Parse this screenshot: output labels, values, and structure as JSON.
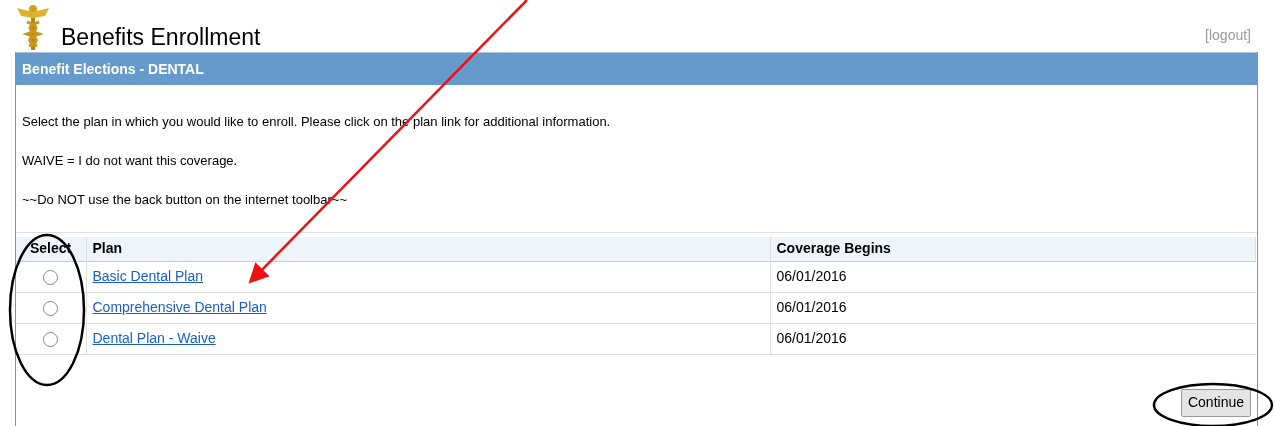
{
  "header": {
    "title": "Benefits Enrollment",
    "logout": "[logout]"
  },
  "panel": {
    "title": "Benefit Elections - DENTAL",
    "instructions": [
      "Select the plan in which you would like to enroll. Please click on the plan link for additional information.",
      "WAIVE = I do not want this coverage.",
      "~~Do NOT use the back button on the internet toolbar~~"
    ],
    "table": {
      "columns": [
        "Select",
        "Plan",
        "Coverage Begins"
      ],
      "rows": [
        {
          "selected": false,
          "plan": "Basic Dental Plan",
          "coverage_begins": "06/01/2016"
        },
        {
          "selected": false,
          "plan": "Comprehensive Dental Plan",
          "coverage_begins": "06/01/2016"
        },
        {
          "selected": false,
          "plan": "Dental Plan - Waive",
          "coverage_begins": "06/01/2016"
        }
      ]
    },
    "button": "Continue"
  }
}
